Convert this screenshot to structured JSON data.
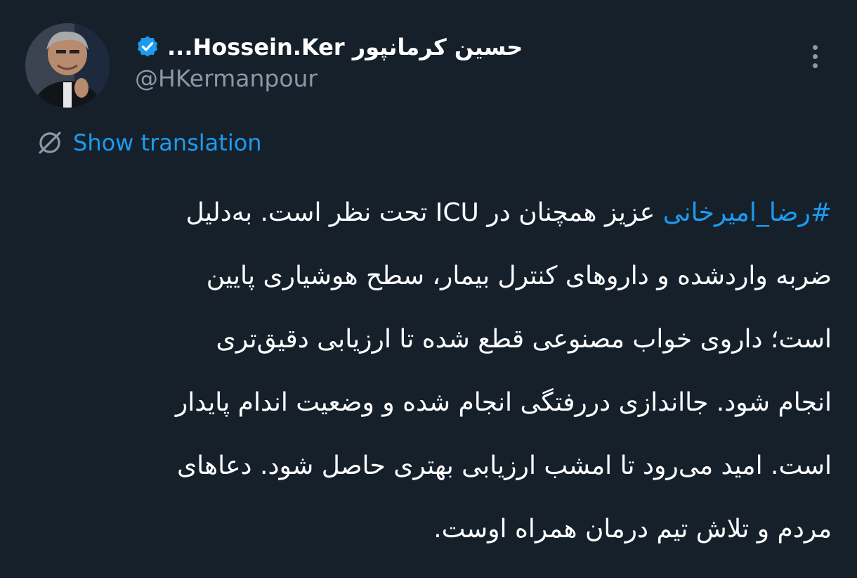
{
  "author": {
    "display_name": "حسین کرمانپور Hossein.Ker...",
    "handle": "@HKermanpour",
    "verified": true,
    "avatar_icon": "profile-photo"
  },
  "actions": {
    "more_icon": "more-vertical-icon"
  },
  "translation": {
    "label": "Show translation",
    "icon": "globe-icon"
  },
  "tweet": {
    "hashtag": "#رضا_امیرخانی",
    "lines": [
      " عزیز همچنان در ICU تحت نظر است. به‌دلیل",
      "ضربه واردشده و داروهای کنترل بیمار، سطح هوشیاری پایین",
      "است؛ داروی خواب مصنوعی قطع شده تا ارزیابی دقیق‌تری",
      "انجام شود. جااندازی دررفتگی انجام شده و وضعیت اندام پایدار",
      "است. امید می‌رود تا امشب ارزیابی بهتری حاصل شود. دعاهای",
      "مردم و تلاش تیم درمان همراه اوست."
    ]
  },
  "colors": {
    "background": "#15202b",
    "text": "#ffffff",
    "secondary": "#8b98a5",
    "accent": "#1d9bf0"
  }
}
